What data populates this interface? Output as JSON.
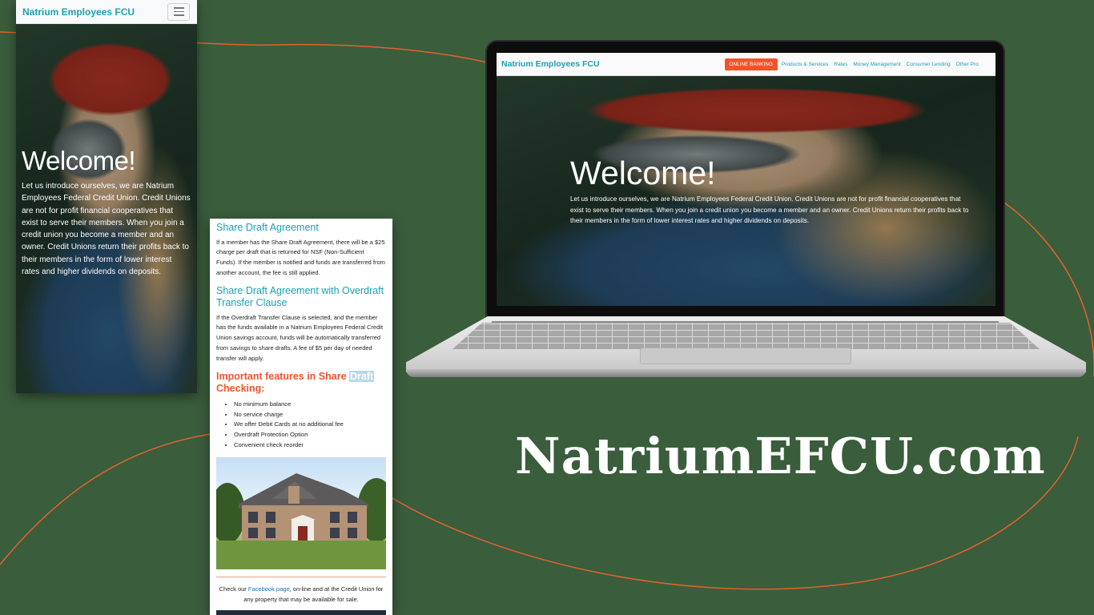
{
  "colors": {
    "background": "#3a5d3c",
    "accent_curve": "#e3622c",
    "brand": "#1aa1b5",
    "button": "#f0542b"
  },
  "mobile_hero": {
    "brand": "Natrium Employees FCU",
    "menu_icon": "hamburger-icon",
    "title": "Welcome!",
    "body": "Let us introduce ourselves, we are Natrium Employees Federal Credit Union. Credit Unions are not for profit financial cooperatives that exist to serve their members. When you join a credit union you become a member and an owner. Credit Unions return their profits back to their members in the form of lower interest rates and higher dividends on deposits."
  },
  "mobile_content": {
    "heading1": "Share Draft Agreement",
    "para1": "If a member has the Share Draft Agreement, there will be a $25 charge per draft that is returned for NSF (Non-Sufficient Funds). If the member is notified and funds are transferred from another account, the fee is still applied.",
    "heading2": "Share Draft Agreement with Overdraft Transfer Clause",
    "para2": "If the Overdraft Transfer Clause is selected, and the member has the funds available in a Natrium Employees Federal Credit Union savings account, funds will be automatically transferred from savings to share drafts. A fee of $5 per day of needed transfer will apply.",
    "heading3_before": "Important features in Share ",
    "heading3_highlight": "Draft",
    "heading3_after": " Checking:",
    "features": [
      "No minimum balance",
      "No service charge",
      "We offer Debit Cards at no additional fee",
      "Overdraft Protection Option",
      "Convenient check reorder"
    ],
    "footer_before": "Check our ",
    "footer_link": "Facebook page",
    "footer_after": ", on-line and at the Credit Union for any property that may be available for sale."
  },
  "desktop": {
    "brand": "Natrium Employees FCU",
    "online_banking": "ONLINE BANKING",
    "nav": [
      "Products & Services",
      "Rates",
      "Money Management",
      "Consumer Lending",
      "Other Pro"
    ],
    "hero_title": "Welcome!",
    "hero_body": "Let us introduce ourselves, we are Natrium Employees Federal Credit Union. Credit Unions are not for profit financial cooperatives that exist to serve their members. When you join a credit union you become a member and an owner. Credit Unions return their profits back to their members in the form of lower interest rates and higher dividends on deposits."
  },
  "site_url": "NatriumEFCU.com"
}
